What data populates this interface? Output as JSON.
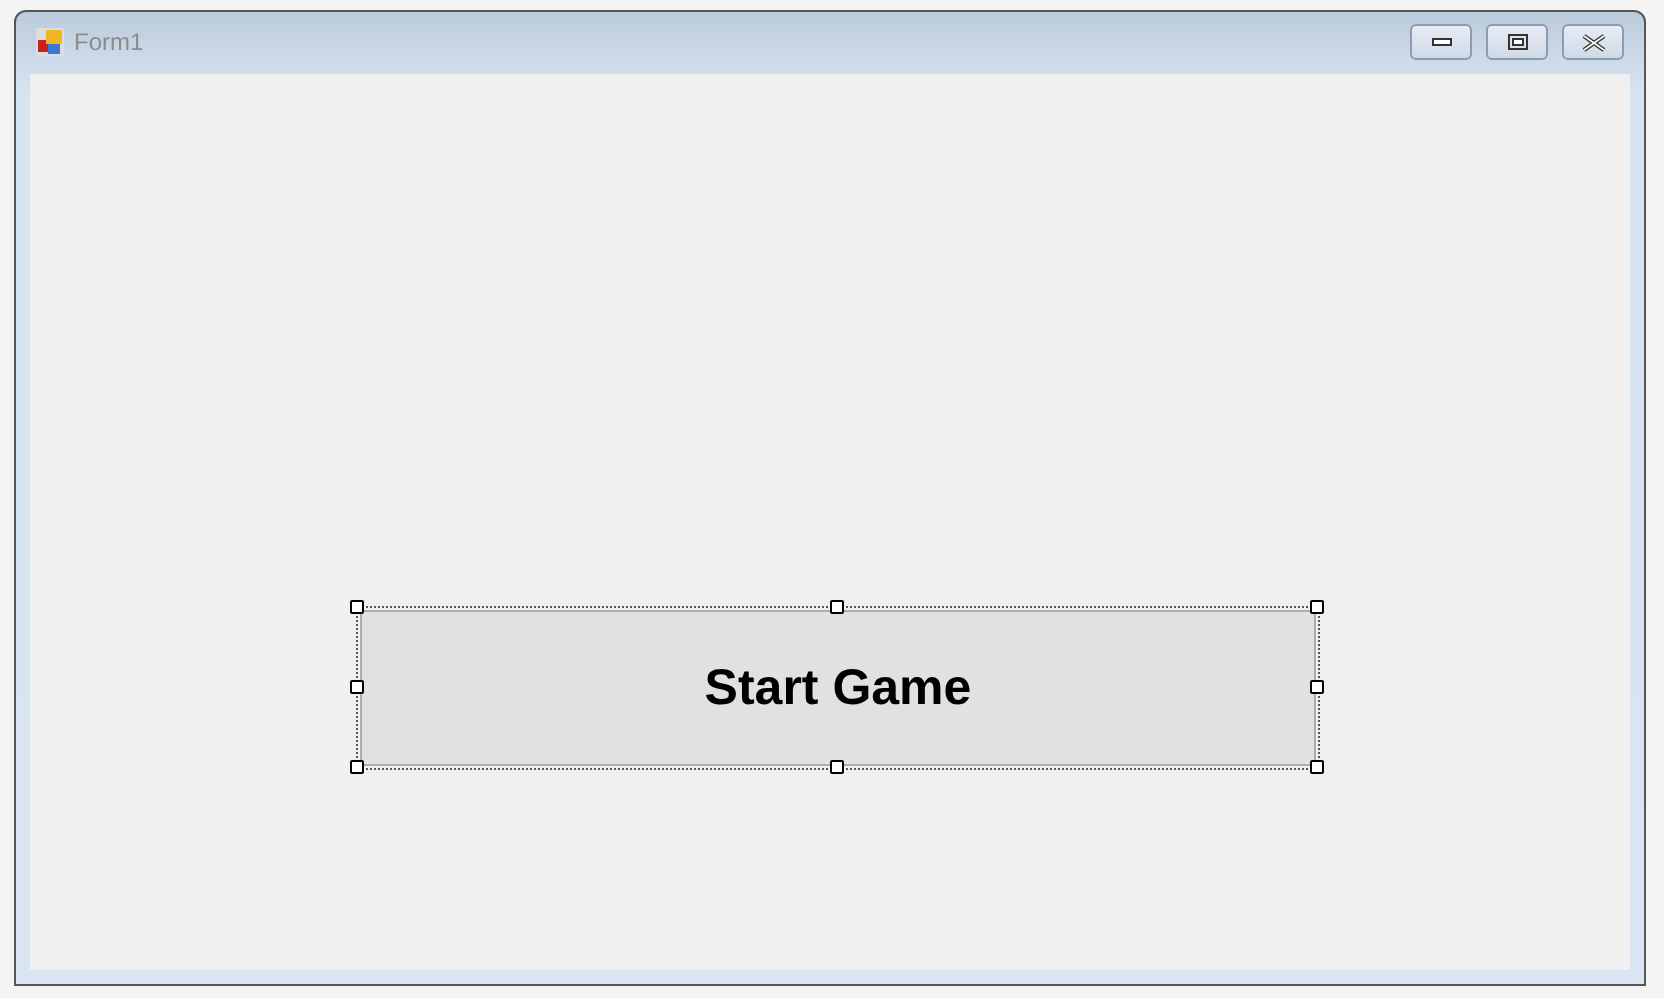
{
  "window": {
    "title": "Form1",
    "active": false
  },
  "form": {
    "button": {
      "label": "Start Game",
      "selected": true
    }
  }
}
